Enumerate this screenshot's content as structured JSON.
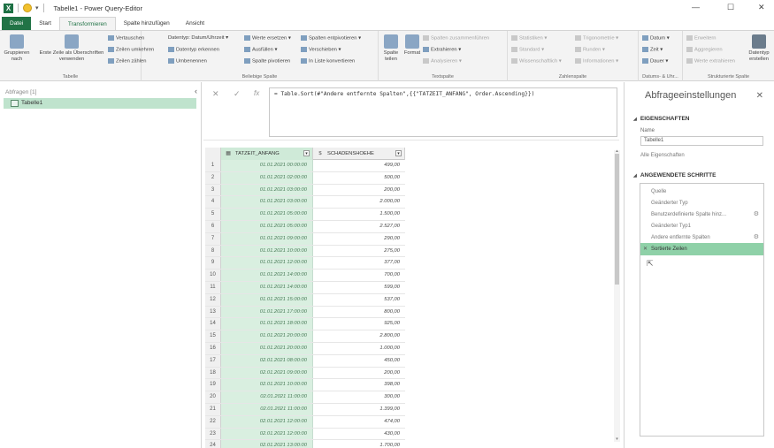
{
  "titlebar": {
    "app_badge": "X",
    "quick_save": "▾",
    "title": "Tabelle1 - Power Query-Editor",
    "minimize": "—",
    "maximize": "☐",
    "close": "✕"
  },
  "tabs": [
    "Datei",
    "Start",
    "Transformieren",
    "Spalte hinzufügen",
    "Ansicht"
  ],
  "ribbon": {
    "table_group": {
      "label": "Tabelle",
      "group_by": "Gruppieren nach",
      "first_row_header": "Erste Zeile als Überschriften verwenden",
      "transpose": "Vertauschen",
      "reverse_rows": "Zeilen umkehren",
      "count_rows": "Zeilen zählen"
    },
    "any_col_group": {
      "label": "Beliebige Spalte",
      "data_type": "Datentyp: Datum/Uhrzeit",
      "detect_type": "Datentyp erkennen",
      "rename": "Umbenennen",
      "replace_values": "Werte ersetzen",
      "fill": "Ausfüllen",
      "pivot": "Spalte pivotieren",
      "unpivot": "Spalten entpivotieren",
      "move": "Verschieben",
      "to_list": "In Liste konvertieren"
    },
    "text_group": {
      "label": "Textspalte",
      "split_column": "Spalte teilen",
      "format": "Format",
      "merge_columns": "Spalten zusammenführen",
      "extract": "Extrahieren",
      "parse": "Analysieren"
    },
    "number_group": {
      "label": "Zahlenspalte",
      "statistics": "Statistiken",
      "standard": "Standard",
      "scientific": "Wissenschaftlich",
      "trigonometry": "Trigonometrie",
      "rounding": "Runden",
      "information": "Informationen"
    },
    "datetime_group": {
      "label": "Datums- & Uhr...",
      "date": "Datum",
      "time": "Zeit",
      "duration": "Dauer"
    },
    "structured_group": {
      "label": "Strukturierte Spalte",
      "expand": "Erweitern",
      "aggregate": "Aggregieren",
      "extract_values": "Werte extrahieren",
      "create_type": "Datentyp erstellen"
    }
  },
  "queries_pane": {
    "header": "Abfragen [1]",
    "items": [
      "Tabelle1"
    ]
  },
  "formula_bar": {
    "cancel": "✕",
    "confirm": "✓",
    "fx": "fx",
    "formula": "= Table.Sort(#\"Andere entfernte Spalten\",{{\"TATZEIT_ANFANG\", Order.Ascending}})"
  },
  "grid": {
    "columns": [
      {
        "type_icon": "▦",
        "name": "TATZEIT_ANFANG"
      },
      {
        "type_icon": "$",
        "name": "SCHADENSHOEHE"
      }
    ],
    "rows": [
      [
        "1",
        "01.01.2021 00:00:00",
        "499,00"
      ],
      [
        "2",
        "01.01.2021 02:00:00",
        "500,00"
      ],
      [
        "3",
        "01.01.2021 03:00:00",
        "200,00"
      ],
      [
        "4",
        "01.01.2021 03:00:00",
        "2.000,00"
      ],
      [
        "5",
        "01.01.2021 05:00:00",
        "1.500,00"
      ],
      [
        "6",
        "01.01.2021 05:00:00",
        "2.527,00"
      ],
      [
        "7",
        "01.01.2021 09:00:00",
        "290,00"
      ],
      [
        "8",
        "01.01.2021 10:00:00",
        "275,00"
      ],
      [
        "9",
        "01.01.2021 12:00:00",
        "377,00"
      ],
      [
        "10",
        "01.01.2021 14:00:00",
        "700,00"
      ],
      [
        "11",
        "01.01.2021 14:00:00",
        "599,00"
      ],
      [
        "12",
        "01.01.2021 15:00:00",
        "537,00"
      ],
      [
        "13",
        "01.01.2021 17:00:00",
        "800,00"
      ],
      [
        "14",
        "01.01.2021 18:00:00",
        "925,00"
      ],
      [
        "15",
        "01.01.2021 20:00:00",
        "2.800,00"
      ],
      [
        "16",
        "01.01.2021 20:00:00",
        "1.000,00"
      ],
      [
        "17",
        "02.01.2021 08:00:00",
        "450,00"
      ],
      [
        "18",
        "02.01.2021 09:00:00",
        "200,00"
      ],
      [
        "19",
        "02.01.2021 10:00:00",
        "398,00"
      ],
      [
        "20",
        "02.01.2021 11:00:00",
        "300,00"
      ],
      [
        "21",
        "02.01.2021 11:00:00",
        "1.399,00"
      ],
      [
        "22",
        "02.01.2021 12:00:00",
        "474,00"
      ],
      [
        "23",
        "02.01.2021 12:00:00",
        "430,00"
      ],
      [
        "24",
        "02.01.2021 13:00:00",
        "1.700,00"
      ]
    ]
  },
  "settings_pane": {
    "title": "Abfrageeinstellungen",
    "close": "✕",
    "properties_header": "EIGENSCHAFTEN",
    "name_label": "Name",
    "name_value": "Tabelle1",
    "all_properties": "Alle Eigenschaften",
    "steps_header": "ANGEWENDETE SCHRITTE",
    "steps": [
      {
        "label": "Quelle",
        "gear": ""
      },
      {
        "label": "Geänderter Typ",
        "gear": ""
      },
      {
        "label": "Benutzerdefinierte Spalte hinz...",
        "gear": "⚙"
      },
      {
        "label": "Geänderter Typ1",
        "gear": ""
      },
      {
        "label": "Andere entfernte Spalten",
        "gear": "⚙"
      },
      {
        "label": "Sortierte Zeilen",
        "gear": ""
      }
    ],
    "active_step_index": 5
  },
  "colors": {
    "accent": "#217346",
    "selected_column": "#d9efe0",
    "active_step": "#8fd1a8"
  }
}
